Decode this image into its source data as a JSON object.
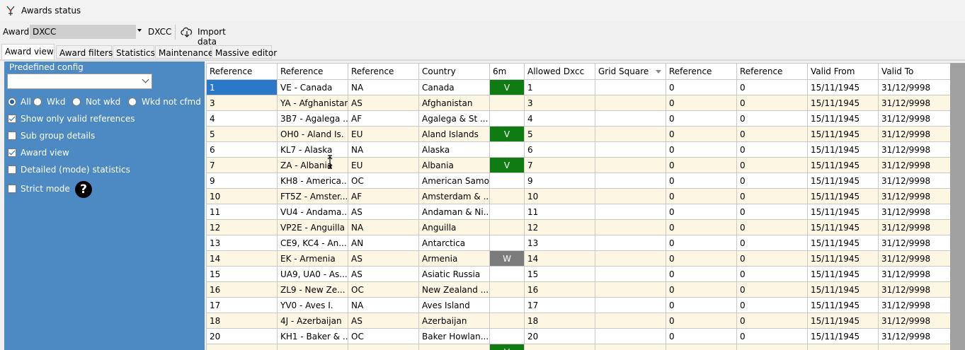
{
  "window": {
    "title": "Awards status"
  },
  "toolbar": {
    "award_label": "Award",
    "award_value": "DXCC",
    "award_name": "DXCC",
    "import_label": "Import data"
  },
  "tabs": [
    "Award view",
    "Award filters",
    "Statistics",
    "Maintenance",
    "Massive editor"
  ],
  "left_panel": {
    "predefined_label": "Predefined config",
    "predefined_value": "",
    "radios": [
      "All",
      "Wkd",
      "Not wkd",
      "Wkd not cfmd"
    ],
    "selected_radio": "All",
    "checkboxes": [
      {
        "label": "Show only valid references",
        "checked": true
      },
      {
        "label": "Sub group details",
        "checked": false
      },
      {
        "label": "Award view",
        "checked": true
      },
      {
        "label": "Detailed (mode) statistics",
        "checked": false
      },
      {
        "label": "Strict mode",
        "checked": false
      }
    ]
  },
  "grid": {
    "headers": [
      "Reference",
      "Reference",
      "Reference",
      "Country",
      "6m",
      "Allowed Dxcc",
      "Grid Square",
      "Reference",
      "Reference",
      "Valid From",
      "Valid To"
    ],
    "rows": [
      [
        "1",
        "VE - Canada",
        "NA",
        "Canada",
        "V",
        "1",
        "",
        "0",
        "0",
        "15/11/1945",
        "31/12/9998"
      ],
      [
        "3",
        "YA - Afghanistan",
        "AS",
        "Afghanistan",
        "",
        "3",
        "",
        "0",
        "0",
        "15/11/1945",
        "31/12/9998"
      ],
      [
        "4",
        "3B7 - Agalega ...",
        "AF",
        "Agalega & St ...",
        "",
        "4",
        "",
        "0",
        "0",
        "15/11/1945",
        "31/12/9998"
      ],
      [
        "5",
        "OH0 - Aland Is.",
        "EU",
        "Aland Islands",
        "V",
        "5",
        "",
        "0",
        "0",
        "15/11/1945",
        "31/12/9998"
      ],
      [
        "6",
        "KL7 - Alaska",
        "NA",
        "Alaska",
        "",
        "6",
        "",
        "0",
        "0",
        "15/11/1945",
        "31/12/9998"
      ],
      [
        "7",
        "ZA - Albania",
        "EU",
        "Albania",
        "V",
        "7",
        "",
        "0",
        "0",
        "15/11/1945",
        "31/12/9998"
      ],
      [
        "9",
        "KH8 - America...",
        "OC",
        "American Samoa",
        "",
        "9",
        "",
        "0",
        "0",
        "15/11/1945",
        "31/12/9998"
      ],
      [
        "10",
        "FT5Z - Amster...",
        "AF",
        "Amsterdam & ...",
        "",
        "10",
        "",
        "0",
        "0",
        "15/11/1945",
        "31/12/9998"
      ],
      [
        "11",
        "VU4 - Andama...",
        "AS",
        "Andaman & Ni...",
        "",
        "11",
        "",
        "0",
        "0",
        "15/11/1945",
        "31/12/9998"
      ],
      [
        "12",
        "VP2E - Anguilla",
        "NA",
        "Anguilla",
        "",
        "12",
        "",
        "0",
        "0",
        "15/11/1945",
        "31/12/9998"
      ],
      [
        "13",
        "CE9, KC4 - An...",
        "AN",
        "Antarctica",
        "",
        "13",
        "",
        "0",
        "0",
        "15/11/1945",
        "31/12/9998"
      ],
      [
        "14",
        "EK - Armenia",
        "AS",
        "Armenia",
        "W",
        "14",
        "",
        "0",
        "0",
        "15/11/1945",
        "31/12/9998"
      ],
      [
        "15",
        "UA9, UA0 - As...",
        "AS",
        "Asiatic Russia",
        "",
        "15",
        "",
        "0",
        "0",
        "15/11/1945",
        "31/12/9998"
      ],
      [
        "16",
        "ZL9 - New Ze...",
        "OC",
        "New Zealand ...",
        "",
        "16",
        "",
        "0",
        "0",
        "15/11/1945",
        "31/12/9998"
      ],
      [
        "17",
        "YV0 - Aves I.",
        "NA",
        "Aves Island",
        "",
        "17",
        "",
        "0",
        "0",
        "15/11/1945",
        "31/12/9998"
      ],
      [
        "18",
        "4J - Azerbaijan",
        "AS",
        "Azerbaijan",
        "",
        "18",
        "",
        "0",
        "0",
        "15/11/1945",
        "31/12/9998"
      ],
      [
        "20",
        "KH1 - Baker & ...",
        "OC",
        "Baker Howlan...",
        "",
        "20",
        "",
        "0",
        "0",
        "15/11/1945",
        "31/12/9998"
      ],
      [
        "",
        "",
        "",
        "",
        "V",
        "",
        "",
        "",
        "",
        "",
        ""
      ]
    ]
  },
  "colors": {
    "panel": "#4d8ac4",
    "confirmed": "#0f7b12",
    "worked": "#7b7b7b",
    "selected": "#2b78c8",
    "row_alt": "#fdf6e3"
  },
  "icons": {
    "app": "antenna-icon",
    "import": "cloud-download-icon",
    "help": "question-icon"
  }
}
